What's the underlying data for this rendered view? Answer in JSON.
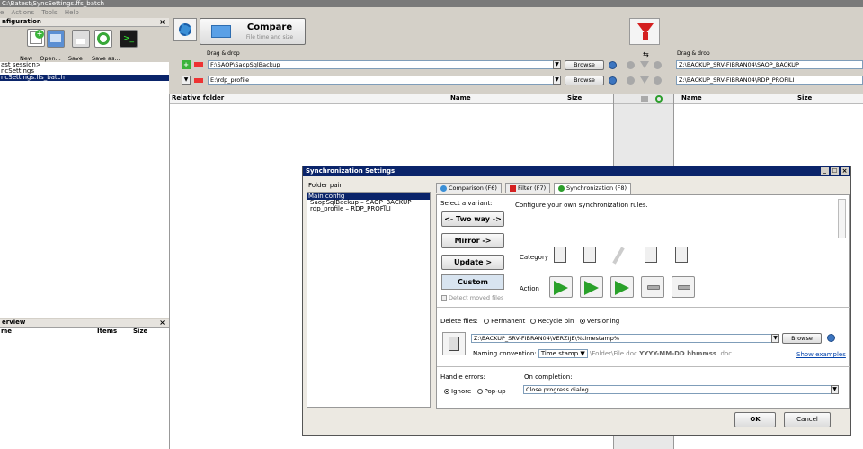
{
  "window": {
    "title": "C:\\Batest\\SyncSettings.ffs_batch"
  },
  "menu": [
    "e",
    "Actions",
    "Tools",
    "Help"
  ],
  "config_panel": {
    "title": "nfiguration",
    "close": "×",
    "tool_labels": [
      "New",
      "Open...",
      "Save",
      "Save as..."
    ],
    "items": [
      "ast session>",
      "ncSettings",
      "ncSettings.ffs_batch"
    ],
    "selected_index": 2
  },
  "overview_panel": {
    "title": "erview",
    "close": "×",
    "columns": [
      "me",
      "Items",
      "Size"
    ]
  },
  "compare_button": {
    "label": "Compare",
    "sublabel": "File time and size"
  },
  "left": {
    "drag_label": "Drag & drop",
    "paths": [
      "F:\\SAOP\\SaopSqlBackup",
      "E:\\rdp_profile"
    ],
    "browse": "Browse",
    "columns": [
      "Relative folder",
      "Name",
      "Size"
    ]
  },
  "right": {
    "drag_label": "Drag & drop",
    "paths": [
      "Z:\\BACKUP_SRV-FIBRAN04\\SAOP_BACKUP",
      "Z:\\BACKUP_SRV-FIBRAN04\\RDP_PROFILI"
    ],
    "columns": [
      "Name",
      "Size"
    ]
  },
  "swap_icon": "⇆",
  "dialog": {
    "title": "Synchronization Settings",
    "title_buttons": [
      "_",
      "□",
      "×"
    ],
    "folder_pair_label": "Folder pair:",
    "folder_pairs": [
      "Main config",
      "SaopSqlBackup – SAOP_BACKUP",
      "rdp_profile – RDP_PROFILI"
    ],
    "tabs": [
      "Comparison (F6)",
      "Filter (F7)",
      "Synchronization (F8)"
    ],
    "active_tab": 2,
    "variant_label": "Select a variant:",
    "variants": [
      "<- Two way ->",
      "Mirror ->",
      "Update >",
      "Custom"
    ],
    "active_variant": 3,
    "detect_moved": "Detect moved files",
    "description": "Configure your own synchronization rules.",
    "category_label": "Category",
    "action_label": "Action",
    "delete_label": "Delete files:",
    "delete_options": [
      "Permanent",
      "Recycle bin",
      "Versioning"
    ],
    "delete_selected": 2,
    "versioning_path": "Z:\\BACKUP_SRV-FIBRAN04\\VERZIJE\\%timestamp%",
    "browse": "Browse",
    "naming_label": "Naming convention:",
    "naming_value": "Time stamp",
    "naming_example_prefix": "\\Folder\\File.doc ",
    "naming_example_bold": "YYYY-MM-DD hhmmss",
    "naming_example_suffix": " .doc",
    "show_examples": "Show examples",
    "errors_label": "Handle errors:",
    "error_options": [
      "Ignore",
      "Pop-up"
    ],
    "error_selected": 0,
    "completion_label": "On completion:",
    "completion_value": "Close progress dialog",
    "ok": "OK",
    "cancel": "Cancel"
  },
  "colors": {
    "selection": "#0a246a",
    "dialog_title": "#0a246a",
    "link": "#0645ad"
  }
}
